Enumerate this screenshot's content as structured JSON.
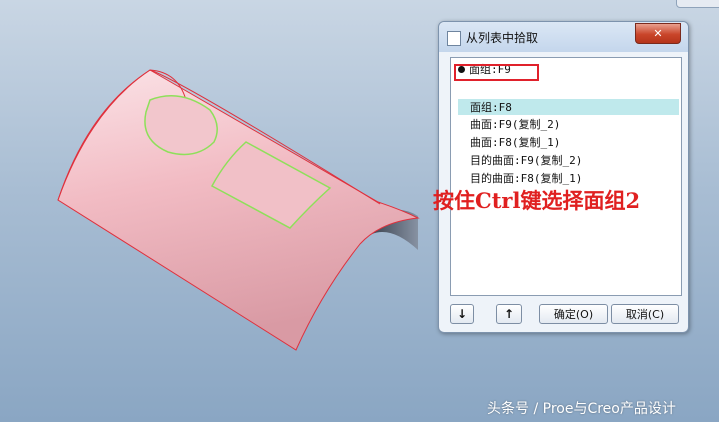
{
  "dialog": {
    "title": "从列表中拾取",
    "close_glyph": "✕",
    "root_item": "面组:F9",
    "items": [
      {
        "label": "面组:F8",
        "selected": true
      },
      {
        "label": "曲面:F9(复制_2)"
      },
      {
        "label": "曲面:F8(复制_1)"
      },
      {
        "label": "目的曲面:F9(复制_2)"
      },
      {
        "label": "目的曲面:F8(复制_1)"
      }
    ],
    "buttons": {
      "move_down": "↓",
      "move_up": "↑",
      "ok": "确定(O)",
      "cancel": "取消(C)"
    }
  },
  "annotation": {
    "text": "按住Ctrl键选择面组2"
  },
  "watermark": "头条号 / Proe与Creo产品设计",
  "colors": {
    "highlight": "#e0212b",
    "selection": "#bfe9ec",
    "annotation": "#e02020",
    "surface_pink": "#f2b8c0",
    "edge_green": "#8ee05a"
  }
}
